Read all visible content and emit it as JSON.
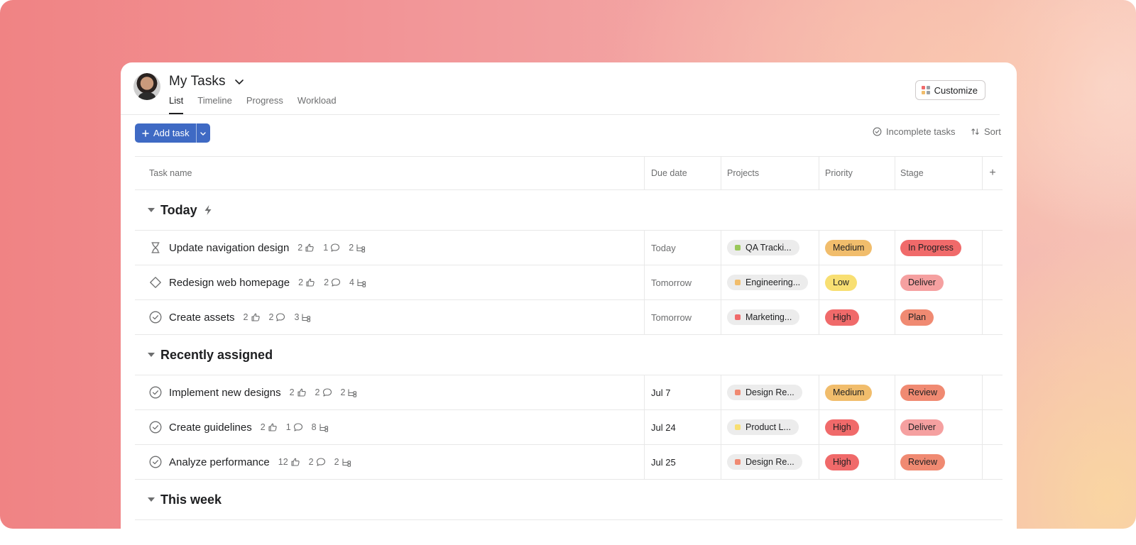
{
  "header": {
    "title": "My Tasks",
    "tabs": [
      {
        "label": "List",
        "active": true
      },
      {
        "label": "Timeline",
        "active": false
      },
      {
        "label": "Progress",
        "active": false
      },
      {
        "label": "Workload",
        "active": false
      }
    ],
    "customize_label": "Customize"
  },
  "toolbar": {
    "add_task_label": "Add task",
    "incomplete_label": "Incomplete tasks",
    "sort_label": "Sort"
  },
  "columns": {
    "task_name": "Task name",
    "due_date": "Due date",
    "projects": "Projects",
    "priority": "Priority",
    "stage": "Stage",
    "add": "+"
  },
  "colors": {
    "accent": "#3f6ac4",
    "priority_medium": "#f1bd6c",
    "priority_low": "#f8df72",
    "priority_high": "#f06a6a",
    "stage_in_progress": "#f06a6a",
    "stage_deliver": "#f5a0a0",
    "stage_plan": "#f08a72",
    "stage_review": "#f08a72"
  },
  "sections": [
    {
      "title": "Today",
      "title_icon": "lightning-icon",
      "tasks": [
        {
          "icon": "hourglass-icon",
          "name": "Update navigation design",
          "likes": "2",
          "comments": "1",
          "subtasks": "2",
          "due": "Today",
          "due_style": "soft",
          "project": "QA Tracki...",
          "project_color": "#9ac75a",
          "priority": "Medium",
          "priority_color": "#f1bd6c",
          "stage": "In Progress",
          "stage_color": "#f06a6a"
        },
        {
          "icon": "diamond-icon",
          "name": "Redesign web homepage",
          "likes": "2",
          "comments": "2",
          "subtasks": "4",
          "due": "Tomorrow",
          "due_style": "soft",
          "project": "Engineering...",
          "project_color": "#f1bd6c",
          "priority": "Low",
          "priority_color": "#f8df72",
          "stage": "Deliver",
          "stage_color": "#f5a0a0"
        },
        {
          "icon": "check-circle-icon",
          "name": "Create assets",
          "likes": "2",
          "comments": "2",
          "subtasks": "3",
          "due": "Tomorrow",
          "due_style": "soft",
          "project": "Marketing...",
          "project_color": "#f06a6a",
          "priority": "High",
          "priority_color": "#f06a6a",
          "stage": "Plan",
          "stage_color": "#f08a72"
        }
      ]
    },
    {
      "title": "Recently assigned",
      "title_icon": "",
      "tasks": [
        {
          "icon": "check-circle-icon",
          "name": "Implement new designs",
          "likes": "2",
          "comments": "2",
          "subtasks": "2",
          "due": "Jul 7",
          "due_style": "hard",
          "project": "Design Re...",
          "project_color": "#f08a72",
          "priority": "Medium",
          "priority_color": "#f1bd6c",
          "stage": "Review",
          "stage_color": "#f08a72"
        },
        {
          "icon": "check-circle-icon",
          "name": "Create guidelines",
          "likes": "2",
          "comments": "1",
          "subtasks": "8",
          "due": "Jul 24",
          "due_style": "hard",
          "project": "Product L...",
          "project_color": "#f8df72",
          "priority": "High",
          "priority_color": "#f06a6a",
          "stage": "Deliver",
          "stage_color": "#f5a0a0"
        },
        {
          "icon": "check-circle-icon",
          "name": "Analyze performance",
          "likes": "12",
          "comments": "2",
          "subtasks": "2",
          "due": "Jul 25",
          "due_style": "hard",
          "project": "Design Re...",
          "project_color": "#f08a72",
          "priority": "High",
          "priority_color": "#f06a6a",
          "stage": "Review",
          "stage_color": "#f08a72"
        }
      ]
    },
    {
      "title": "This week",
      "title_icon": "",
      "tasks": []
    }
  ]
}
